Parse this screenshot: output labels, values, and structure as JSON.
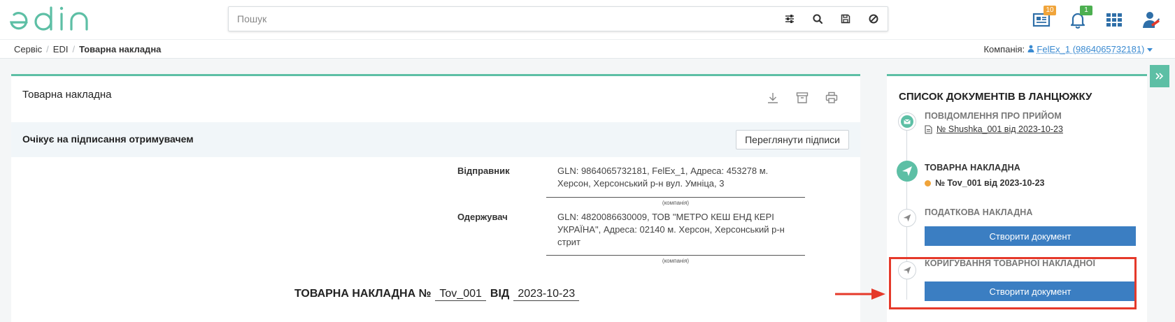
{
  "app": {
    "logo_text": "edin"
  },
  "search": {
    "placeholder": "Пошук",
    "buttons": [
      "sliders-icon",
      "search-icon",
      "save-icon",
      "ban-icon"
    ]
  },
  "header_icons": {
    "documents_badge": "10",
    "notifications_badge": "1",
    "colors": {
      "documents_badge": "#f0a43a",
      "notifications_badge": "#4caf50"
    }
  },
  "breadcrumb": {
    "items": [
      "Сервіс",
      "EDI"
    ],
    "current": "Товарна накладна"
  },
  "company": {
    "label": "Компанія:",
    "value": "FelEx_1 (9864065732181)"
  },
  "document": {
    "title": "Товарна накладна",
    "status": "Очікує на підписання отримувачем",
    "view_signatures": "Переглянути підписи",
    "sender": {
      "label": "Відправник",
      "value": "GLN: 9864065732181, FelEx_1, Адреса: 453278 м. Херсон, Херсонський р-н вул. Умніца, 3",
      "caption": "(компанія)"
    },
    "receiver": {
      "label": "Одержувач",
      "value": "GLN: 4820086630009, ТОВ \"МЕТРО КЕШ ЕНД КЕРІ УКРАЇНА\", Адреса: 02140 м. Херсон, Херсонський р-н стрит",
      "caption": "(компанія)"
    },
    "heading_prefix": "ТОВАРНА НАКЛАДНА №",
    "number": "Tov_001",
    "date_label": "ВІД",
    "date": "2023-10-23"
  },
  "chain": {
    "title": "СПИСОК ДОКУМЕНТІВ В ЛАНЦЮЖКУ",
    "items": [
      {
        "name": "ПОВІДОМЛЕННЯ ПРО ПРИЙОМ",
        "link": "№ Shushka_001 від 2023-10-23"
      },
      {
        "name": "ТОВАРНА НАКЛАДНА",
        "link": "№ Tov_001 від 2023-10-23"
      },
      {
        "name": "ПОДАТКОВА НАКЛАДНА",
        "button": "Створити документ"
      },
      {
        "name": "КОРИГУВАННЯ ТОВАРНОЇ НАКЛАДНОЇ",
        "button": "Створити документ"
      }
    ],
    "accent_color": "#5dbfa5",
    "highlight_color": "#e5392a"
  }
}
